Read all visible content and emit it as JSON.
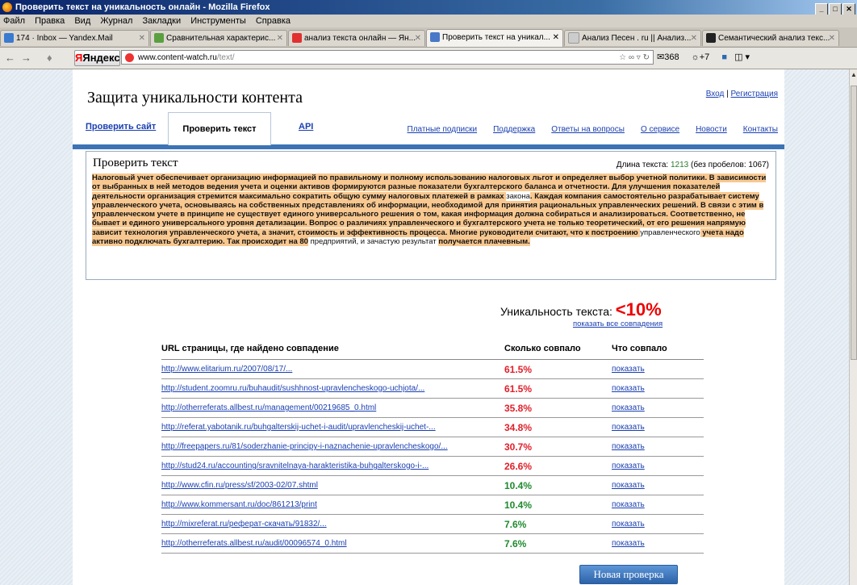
{
  "window": {
    "title": "Проверить текст на уникальность онлайн - Mozilla Firefox"
  },
  "menu": [
    "Файл",
    "Правка",
    "Вид",
    "Журнал",
    "Закладки",
    "Инструменты",
    "Справка"
  ],
  "tabs": [
    {
      "label": "174 · Inbox — Yandex.Mail",
      "color": "#3a7ad0"
    },
    {
      "label": "Сравнительная характерис...",
      "color": "#5aa040"
    },
    {
      "label": "анализ текста онлайн — Ян...",
      "color": "#e03030"
    },
    {
      "label": "Проверить текст на уникал...",
      "color": "#4a78c8",
      "active": true
    },
    {
      "label": "Анализ Песен . ru || Анализ...",
      "color": "#cccccc"
    },
    {
      "label": "Семантический анализ текс...",
      "color": "#222222"
    }
  ],
  "navbar": {
    "yandex": "Яндекс",
    "url_host": "www.content-watch.ru",
    "url_path": "/text/",
    "mail_count": "368",
    "weather": "+7"
  },
  "site": {
    "title": "Защита уникальности контента",
    "login": "Вход",
    "separator": "|",
    "register": "Регистрация",
    "nav_site": "Проверить сайт",
    "nav_text": "Проверить текст",
    "nav_api": "API",
    "nav_right": [
      "Платные подписки",
      "Поддержка",
      "Ответы на вопросы",
      "О сервисе",
      "Новости",
      "Контакты"
    ]
  },
  "check": {
    "title": "Проверить текст",
    "length_label": "Длина текста:",
    "length_value": "1213",
    "length_nospace": "(без пробелов: 1067)",
    "text_parts": [
      {
        "t": "Налоговый учет обеспечивает организацию информацией по правильному и полному использованию налоговых льгот и определяет выбор учетной политики. В зависимости от выбранных в ней методов ведения учета и оценки активов формируются разные показатели бухгалтерского баланса и отчетности. Для улучшения показателей деятельности организация стремится максимально сократить общую сумму налоговых платежей в рамках ",
        "h": true
      },
      {
        "t": "закона",
        "h": false
      },
      {
        "t": ". Каждая компания самостоятельно разрабатывает систему управленческого учета, основываясь на собственных представлениях об информации, необходимой для принятия рациональных управленческих решений. В связи с этим в управленческом учете в принципе не существует единого универсального решения о том, какая информация должна собираться и анализироваться. Соответственно, не бывает и единого универсального уровня детализации. Вопрос о различиях управленческого и бухгалтерского учета не только теоретический, от его решения напрямую зависит технология управленческого учета, а значит, стоимость и эффективность процесса. Многие руководители считают, что к построению ",
        "h": true
      },
      {
        "t": "управленческого",
        "h": false
      },
      {
        "t": " учета надо активно подключать бухгалтерию. Так происходит на 80",
        "h": true
      },
      {
        "t": " предприятий, и зачастую результат ",
        "h": false
      },
      {
        "t": "получается плачевным.",
        "h": true
      }
    ]
  },
  "uniqueness": {
    "label": "Уникальность текста:",
    "value": "<10%",
    "show_all": "показать все совпадения"
  },
  "results": {
    "headers": [
      "URL страницы, где найдено совпадение",
      "Сколько совпало",
      "Что совпало"
    ],
    "rows": [
      {
        "url": "http://www.elitarium.ru/2007/08/17/...",
        "pct": "61.5%",
        "color": "red",
        "action": "показать"
      },
      {
        "url": "http://student.zoomru.ru/buhaudit/sushhnost-upravlencheskogo-uchjota/...",
        "pct": "61.5%",
        "color": "red",
        "action": "показать"
      },
      {
        "url": "http://otherreferats.allbest.ru/management/00219685_0.html",
        "pct": "35.8%",
        "color": "red",
        "action": "показать"
      },
      {
        "url": "http://referat.yabotanik.ru/buhgalterskij-uchet-i-audit/upravlencheskij-uchet-...",
        "pct": "34.8%",
        "color": "red",
        "action": "показать"
      },
      {
        "url": "http://freepapers.ru/81/soderzhanie-principy-i-naznachenie-upravlencheskogo/...",
        "pct": "30.7%",
        "color": "red",
        "action": "показать"
      },
      {
        "url": "http://stud24.ru/accounting/sravnitelnaya-harakteristika-buhgalterskogo-i-...",
        "pct": "26.6%",
        "color": "red",
        "action": "показать"
      },
      {
        "url": "http://www.cfin.ru/press/sf/2003-02/07.shtml",
        "pct": "10.4%",
        "color": "green",
        "action": "показать"
      },
      {
        "url": "http://www.kommersant.ru/doc/861213/print",
        "pct": "10.4%",
        "color": "green",
        "action": "показать"
      },
      {
        "url": "http://mixreferat.ru/реферат-скачать/91832/...",
        "pct": "7.6%",
        "color": "green",
        "action": "показать"
      },
      {
        "url": "http://otherreferats.allbest.ru/audit/00096574_0.html",
        "pct": "7.6%",
        "color": "green",
        "action": "показать"
      }
    ]
  },
  "new_check": "Новая проверка"
}
